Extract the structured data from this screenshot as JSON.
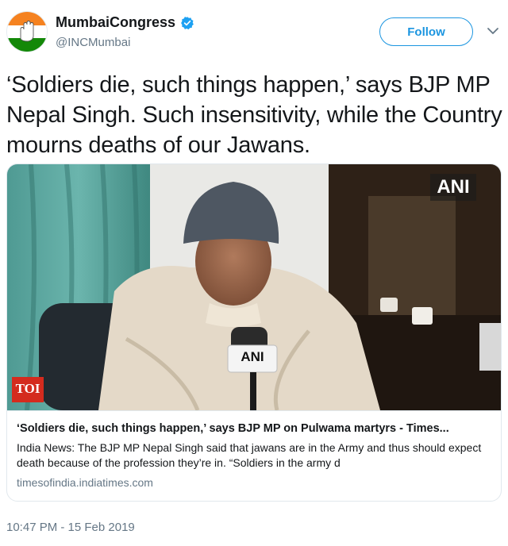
{
  "account": {
    "display_name": "MumbaiCongress",
    "handle": "@INCMumbai",
    "verified": true,
    "avatar_icon": "congress-hand-logo-icon"
  },
  "follow": {
    "label": "Follow"
  },
  "tweet": {
    "text": "‘Soldiers die, such things happen,’ says BJP MP Nepal Singh. Such insensitivity,  while the Country mourns deaths of our Jawans.",
    "timestamp": "10:47 PM - 15 Feb 2019"
  },
  "card": {
    "image": {
      "watermark": "ANI",
      "mic_label": "ANI",
      "source_badge": "TOI"
    },
    "title": "‘Soldiers die, such things happen,’ says BJP MP on Pulwama martyrs - Times...",
    "description": "India News: The BJP MP Nepal Singh said that jawans are in the Army and thus should expect death because of the profession they’re in. “Soldiers in the army d",
    "domain": "timesofindia.indiatimes.com"
  },
  "colors": {
    "accent": "#1b95e0",
    "text": "#14171a",
    "secondary": "#657786",
    "border": "#e1e8ed"
  }
}
